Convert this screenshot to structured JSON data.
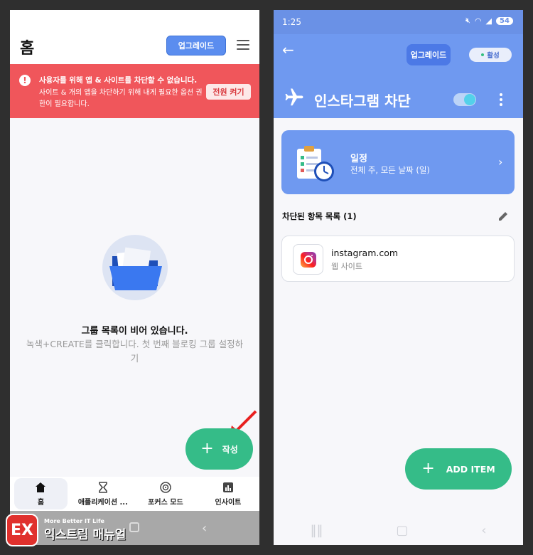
{
  "left": {
    "header": {
      "title": "홈",
      "upgrade_label": "업그레이드"
    },
    "alert": {
      "title": "사용자를 위해 앱 & 사이트를 차단할 수 없습니다.",
      "body": "사이트 & 개의 앱을 차단하기 위해 내게 필요한 옵션 권한이 필요합니다.",
      "button_label": "전원 켜기"
    },
    "empty_state": {
      "title": "그룹 목록이 비어 있습니다.",
      "subtitle_prefix": "녹색+CREATE를 클릭합니다.",
      "subtitle_rest": "첫 번째 블로킹 그룹 설정하기"
    },
    "fab_label": "작성",
    "nav": [
      {
        "label": "홈",
        "icon": "home-icon"
      },
      {
        "label": "애플리케이션 ...",
        "icon": "hourglass-icon"
      },
      {
        "label": "포커스 모드",
        "icon": "target-icon"
      },
      {
        "label": "인사이트",
        "icon": "chart-icon"
      }
    ]
  },
  "right": {
    "status": {
      "time": "1:25",
      "battery": "54"
    },
    "header": {
      "upgrade_label": "업그레이드",
      "active_label": "활성",
      "title": "인스타그램 차단"
    },
    "schedule": {
      "title": "일정",
      "subtitle": "전체 주, 모든 날짜 (일)"
    },
    "blocked_label": "차단된 항목 목록 (1)",
    "item": {
      "title": "instagram.com",
      "subtitle": "웹 사이트"
    },
    "fab_label": "ADD ITEM"
  },
  "watermark": {
    "small": "More Better IT Life",
    "big": "익스트림 매뉴얼",
    "logo": "EX"
  },
  "colors": {
    "accent_blue": "#6f99f0",
    "alert_red": "#f0565b",
    "fab_green": "#35bc88"
  }
}
